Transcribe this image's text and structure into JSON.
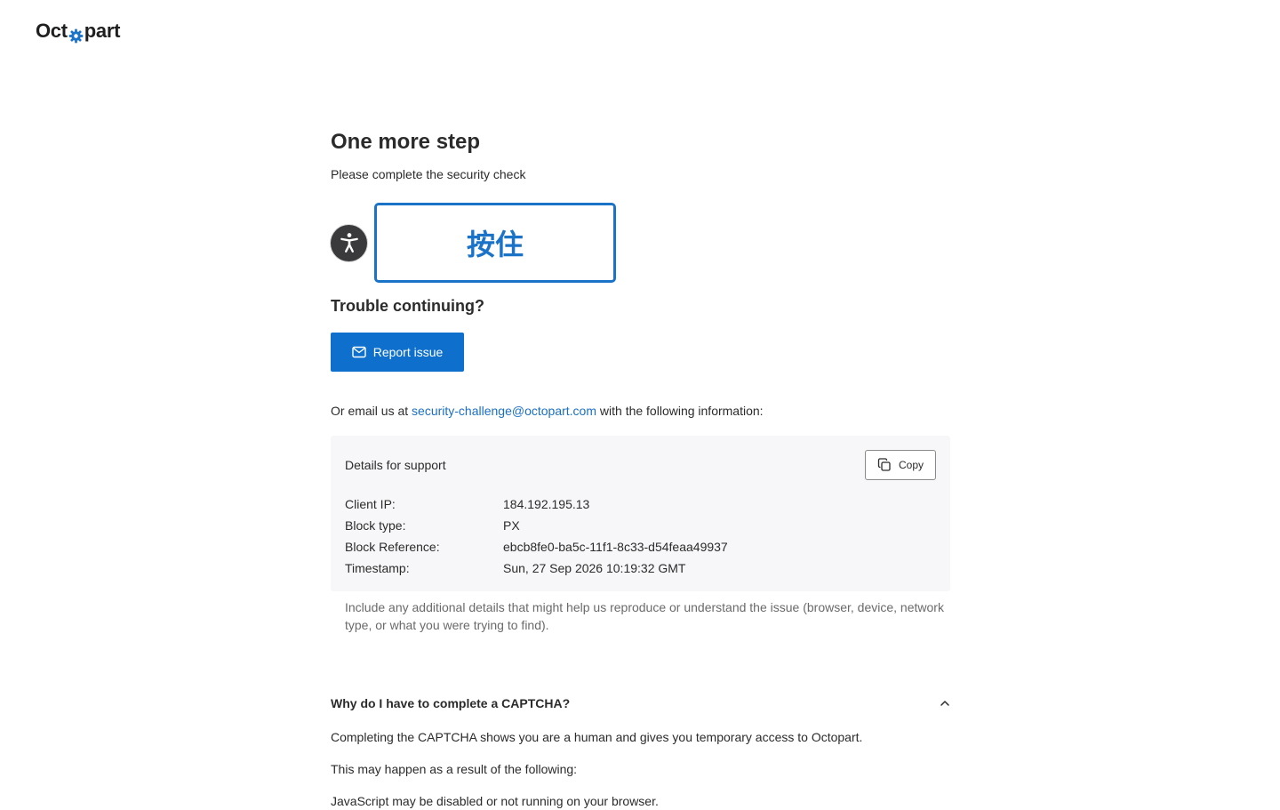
{
  "brand": {
    "logo_left": "Oct",
    "logo_right": "part",
    "accent": "#1a73c7"
  },
  "page": {
    "title": "One more step",
    "subtitle": "Please complete the security check"
  },
  "captcha": {
    "hold_label": "按住",
    "accessibility_icon": "accessibility-icon"
  },
  "trouble": {
    "heading": "Trouble continuing?",
    "report_label": "Report issue",
    "report_icon": "mail-icon"
  },
  "email": {
    "prefix": "Or email us at ",
    "address": "security-challenge@octopart.com",
    "suffix": " with the following information:"
  },
  "support": {
    "title": "Details for support",
    "copy_label": "Copy",
    "copy_icon": "copy-icon",
    "rows": [
      {
        "key": "Client IP:",
        "value": "184.192.195.13"
      },
      {
        "key": "Block type:",
        "value": "PX"
      },
      {
        "key": "Block Reference:",
        "value": "ebcb8fe0-ba5c-11f1-8c33-d54feaa49937"
      },
      {
        "key": "Timestamp:",
        "value": "Sun, 27 Sep 2026 10:19:32 GMT"
      }
    ],
    "note": "Include any additional details that might help us reproduce or understand the issue (browser, device, network type, or what you were trying to find)."
  },
  "faq": {
    "question": "Why do I have to complete a CAPTCHA?",
    "answer1": "Completing the CAPTCHA shows you are a human and gives you temporary access to Octopart.",
    "answer2": "This may happen as a result of the following:",
    "answer3": "JavaScript may be disabled or not running on your browser."
  }
}
